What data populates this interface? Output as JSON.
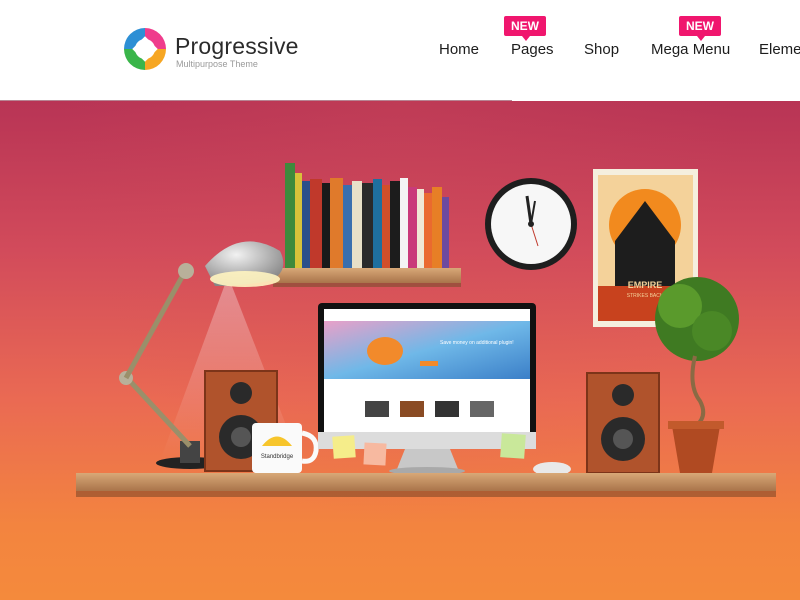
{
  "brand": {
    "name": "Progressive",
    "tagline": "Multipurpose Theme"
  },
  "nav": {
    "items": [
      {
        "label": "Home",
        "badge": ""
      },
      {
        "label": "Pages",
        "badge": "NEW"
      },
      {
        "label": "Shop",
        "badge": ""
      },
      {
        "label": "Mega Menu",
        "badge": "NEW"
      },
      {
        "label": "Elements",
        "badge": ""
      }
    ]
  },
  "hero": {
    "mug_text": "Standbridge",
    "poster_text": "EMPIRE",
    "poster_subtext": "STRIKES BACK",
    "monitor_headline": "Save money on additional plugin!"
  },
  "colors": {
    "badge": "#f0166e",
    "hero_top": "#b83455",
    "hero_bottom": "#f48a3c"
  }
}
